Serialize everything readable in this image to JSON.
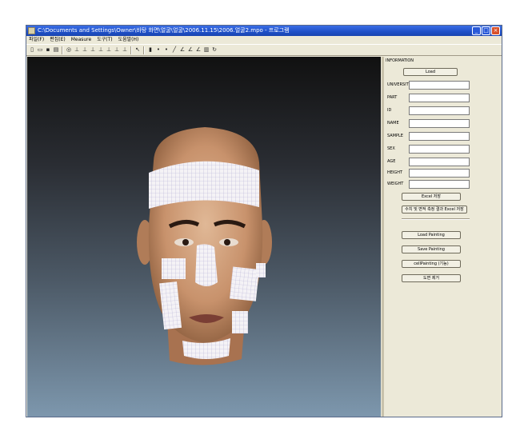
{
  "window": {
    "title": "C:\\Documents and Settings\\Owner\\바탕 화면\\얼굴\\얼굴\\2006.11.15\\2006.얼굴2.mpo - 프로그램"
  },
  "menu": [
    "파일(F)",
    "편집(E)",
    "Measure",
    "도구(T)",
    "도움말(H)"
  ],
  "toolbar_icons": [
    "new-icon",
    "open-icon",
    "save-icon",
    "print-icon",
    "sep",
    "zoom-icon",
    "measure-icon",
    "measure-icon",
    "measure-icon",
    "measure-icon",
    "measure-icon",
    "measure-icon",
    "measure-icon",
    "sep",
    "pointer-icon",
    "sep",
    "marker-icon",
    "point-icon",
    "point-icon",
    "line-icon",
    "angle-icon",
    "angle-icon",
    "angle-icon",
    "chart-icon",
    "rotate-icon"
  ],
  "panel": {
    "title": "INFORMATION",
    "load_label": "Load",
    "fields": [
      "UNIVERSITY",
      "PART",
      "ID",
      "NAME",
      "SAMPLE",
      "SEX",
      "AGE",
      "HEIGHT",
      "WEIGHT"
    ],
    "excel_label": "Excel 저장",
    "excel_all_label": "수치 및 면적 측정 결과 Excel 저장",
    "load_painting_label": "Load Painting",
    "save_painting_label": "Save Painting",
    "cell_painting_label": "cellPainting (기능)",
    "delete_label": "도면 제거"
  },
  "colors": {
    "title_bar": "#1f50c8",
    "panel_bg": "#ece9d8",
    "skin": "#c89a78",
    "tape_grid": "#c8c8e8"
  }
}
